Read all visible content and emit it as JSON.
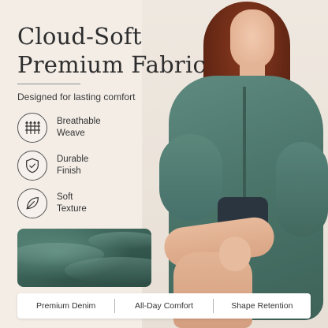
{
  "heading": {
    "line1": "Cloud-Soft",
    "line2": "Premium Fabric"
  },
  "subtitle": "Designed for lasting comfort",
  "features": [
    {
      "icon": "breathable-weave-icon",
      "line1": "Breathable",
      "line2": "Weave"
    },
    {
      "icon": "shield-check-icon",
      "line1": "Durable",
      "line2": "Finish"
    },
    {
      "icon": "leaf-icon",
      "line1": "Soft",
      "line2": "Texture"
    }
  ],
  "bottom_bar": {
    "items": [
      "Premium Denim",
      "All-Day Comfort",
      "Shape Retention"
    ]
  },
  "colors": {
    "background": "#f3ede6",
    "fabric_green": "#4b756a",
    "text": "#2d2d2d"
  }
}
